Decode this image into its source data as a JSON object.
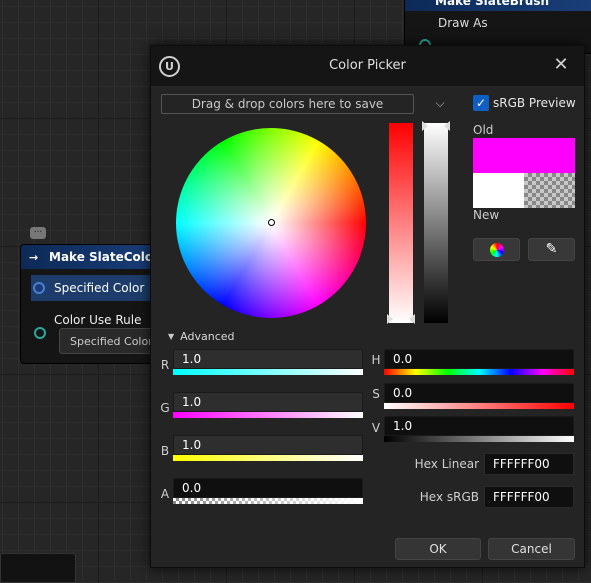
{
  "background": {
    "slatebrush_node": {
      "title": "Make SlateBrush",
      "row_label": "Draw As"
    },
    "slatecolor_node": {
      "title": "Make SlateColor",
      "specified_color_label": "Specified Color",
      "specified_color_value": "#ff00ff",
      "color_use_rule_label": "Color Use Rule",
      "color_use_rule_value": "Specified Color"
    }
  },
  "dialog": {
    "title": "Color Picker",
    "dropzone_label": "Drag & drop colors here to save",
    "srgb_preview_label": "sRGB Preview",
    "srgb_preview_checked": true,
    "old_label": "Old",
    "new_label": "New",
    "old_color": "#ff00ff",
    "new_color": "#ffffff",
    "advanced_label": "Advanced",
    "channels": {
      "r": {
        "label": "R",
        "value": "1.0"
      },
      "g": {
        "label": "G",
        "value": "1.0"
      },
      "b": {
        "label": "B",
        "value": "1.0"
      },
      "a": {
        "label": "A",
        "value": "0.0"
      },
      "h": {
        "label": "H",
        "value": "0.0"
      },
      "s": {
        "label": "S",
        "value": "0.0"
      },
      "v": {
        "label": "V",
        "value": "1.0"
      }
    },
    "hex_linear_label": "Hex Linear",
    "hex_linear_value": "FFFFFF00",
    "hex_srgb_label": "Hex sRGB",
    "hex_srgb_value": "FFFFFF00",
    "ok_label": "OK",
    "cancel_label": "Cancel"
  }
}
